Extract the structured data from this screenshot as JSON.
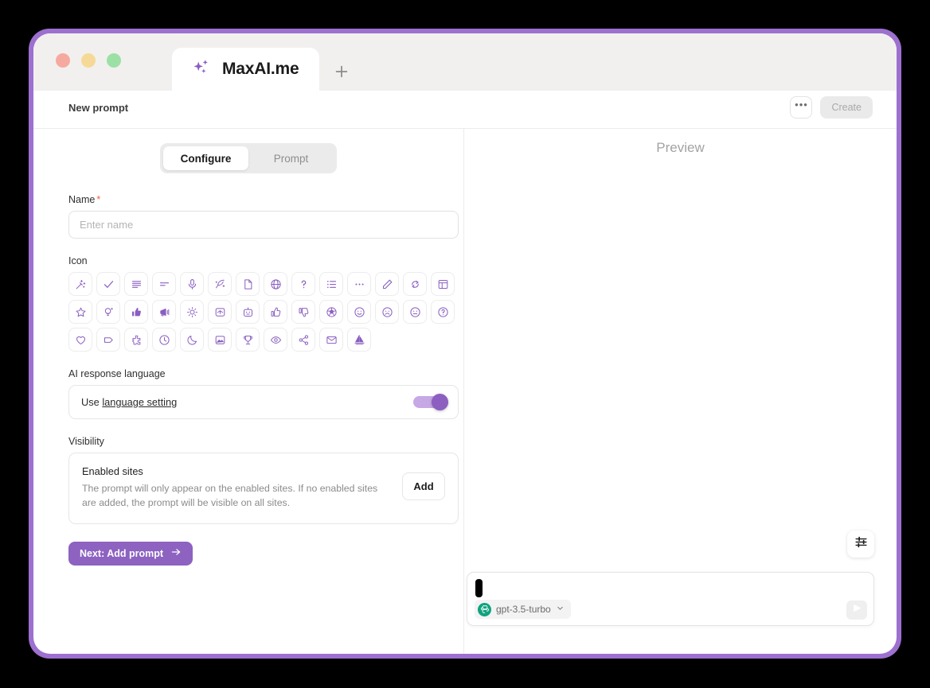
{
  "browser": {
    "tab_title": "MaxAI.me",
    "tab_icon": "sparkle-icon",
    "new_tab_label": "+",
    "traffic_lights": [
      "close",
      "minimize",
      "maximize"
    ]
  },
  "header": {
    "title": "New prompt",
    "more_label": "•••",
    "create_label": "Create"
  },
  "tabs": [
    {
      "label": "Configure",
      "active": true
    },
    {
      "label": "Prompt",
      "active": false
    }
  ],
  "form": {
    "name": {
      "label": "Name",
      "required_marker": "*",
      "value": "",
      "placeholder": "Enter name"
    },
    "icon": {
      "label": "Icon",
      "items": [
        "magic-wand-icon",
        "check-icon",
        "text-lines-icon",
        "short-lines-icon",
        "microphone-icon",
        "feather-sparkle-icon",
        "document-icon",
        "globe-icon",
        "question-mark-icon",
        "bullet-list-icon",
        "ellipsis-icon",
        "pencil-icon",
        "refresh-icon",
        "table-icon",
        "star-icon",
        "lightbulb-idea-icon",
        "thumbs-up-filled-icon",
        "megaphone-icon",
        "sun-icon",
        "graduation-cap-icon",
        "robot-icon",
        "thumbs-up-outline-icon",
        "thumbs-down-icon",
        "soccer-ball-icon",
        "smiley-happy-icon",
        "smiley-sad-icon",
        "smiley-neutral-icon",
        "question-circle-icon",
        "heart-icon",
        "tag-icon",
        "puzzle-piece-icon",
        "clock-icon",
        "moon-icon",
        "image-icon",
        "trophy-icon",
        "eye-icon",
        "share-icon",
        "envelope-icon",
        "sailboat-icon"
      ]
    },
    "language": {
      "label": "AI response language",
      "prefix": "Use ",
      "link": "language setting",
      "toggle_on": true
    },
    "visibility": {
      "label": "Visibility",
      "title": "Enabled sites",
      "description": "The prompt will only appear on the enabled sites. If no enabled sites are added, the prompt will be visible on all sites.",
      "add_label": "Add"
    },
    "next_label": "Next: Add prompt",
    "next_icon": "arrow-right-icon"
  },
  "preview": {
    "title": "Preview",
    "settings_icon": "sliders-icon",
    "composer": {
      "value": "",
      "model": "gpt-3.5-turbo",
      "model_icon": "openai-icon",
      "chevron_icon": "chevron-down-icon",
      "send_icon": "send-icon"
    }
  },
  "colors": {
    "frame_purple": "#9d70d0",
    "accent_purple": "#8d62c1",
    "icon_purple": "#8a5fc0",
    "required_red": "#f0603c",
    "openai_green": "#10a37f"
  }
}
